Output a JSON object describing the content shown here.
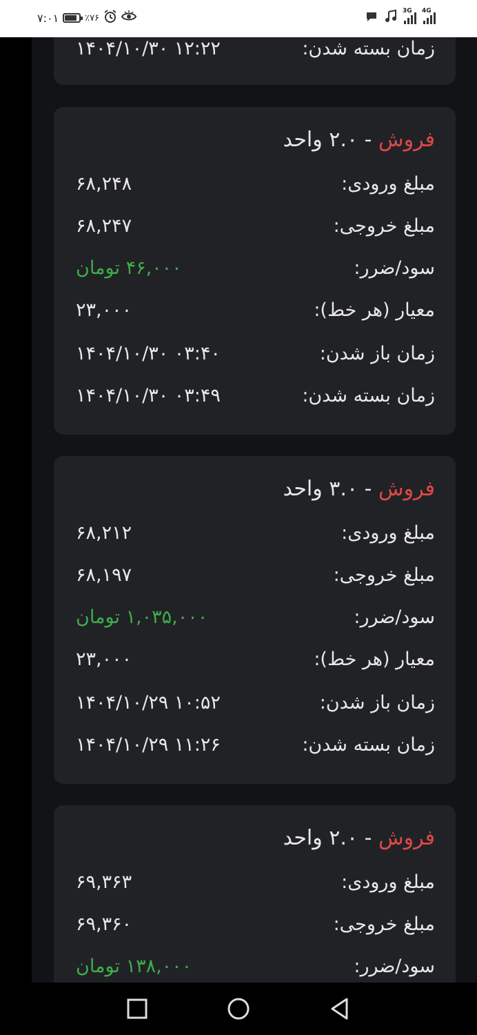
{
  "status_bar": {
    "time": "۷:۰۱",
    "battery": "٪۷۶",
    "battery_level": 0.76,
    "network_3g": "3G",
    "network_4g": "4G"
  },
  "partial_card": {
    "close_label": "زمان بسته شدن:",
    "close_value": "۱۴۰۴/۱۰/۳۰ ۱۲:۲۲"
  },
  "trades": [
    {
      "side": "فروش",
      "separator": "-",
      "amount": "۲.۰ واحد",
      "rows": [
        {
          "label": "مبلغ ورودی:",
          "value": "۶۸,۲۴۸"
        },
        {
          "label": "مبلغ خروجی:",
          "value": "۶۸,۲۴۷"
        },
        {
          "label": "سود/ضرر:",
          "value": "۴۶,۰۰۰ تومان",
          "profit": true
        },
        {
          "label": "معیار (هر خط):",
          "value": "۲۳,۰۰۰"
        },
        {
          "label": "زمان باز شدن:",
          "value": "۱۴۰۴/۱۰/۳۰ ۰۳:۴۰"
        },
        {
          "label": "زمان بسته شدن:",
          "value": "۱۴۰۴/۱۰/۳۰ ۰۳:۴۹"
        }
      ]
    },
    {
      "side": "فروش",
      "separator": "-",
      "amount": "۳.۰ واحد",
      "rows": [
        {
          "label": "مبلغ ورودی:",
          "value": "۶۸,۲۱۲"
        },
        {
          "label": "مبلغ خروجی:",
          "value": "۶۸,۱۹۷"
        },
        {
          "label": "سود/ضرر:",
          "value": "۱,۰۳۵,۰۰۰ تومان",
          "profit": true
        },
        {
          "label": "معیار (هر خط):",
          "value": "۲۳,۰۰۰"
        },
        {
          "label": "زمان باز شدن:",
          "value": "۱۴۰۴/۱۰/۲۹ ۱۰:۵۲"
        },
        {
          "label": "زمان بسته شدن:",
          "value": "۱۴۰۴/۱۰/۲۹ ۱۱:۲۶"
        }
      ]
    },
    {
      "side": "فروش",
      "separator": "-",
      "amount": "۲.۰ واحد",
      "rows": [
        {
          "label": "مبلغ ورودی:",
          "value": "۶۹,۳۶۳"
        },
        {
          "label": "مبلغ خروجی:",
          "value": "۶۹,۳۶۰"
        },
        {
          "label": "سود/ضرر:",
          "value": "۱۳۸,۰۰۰ تومان",
          "profit": true
        }
      ]
    }
  ],
  "colors": {
    "sell": "#e04848",
    "profit": "#3fae4a",
    "card_bg": "#212226",
    "page_bg": "#121316"
  }
}
